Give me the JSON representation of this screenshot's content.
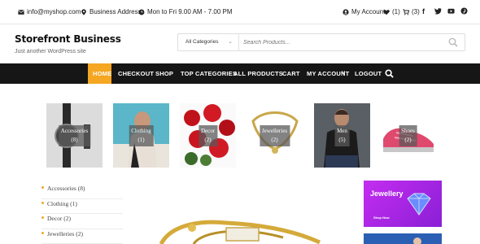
{
  "topbar": {
    "email": "info@myshop.com",
    "address": "Business Address",
    "hours": "Mon to Fri 9.00 AM - 7.00 PM",
    "account": "My Account",
    "wishlist_count": "(1)",
    "cart_count": "(3)",
    "social": [
      "f",
      "t",
      "y",
      "p"
    ]
  },
  "header": {
    "title": "Storefront Business",
    "tagline": "Just another WordPress site"
  },
  "search": {
    "category": "All Categories",
    "placeholder": "Search Products..."
  },
  "nav": {
    "items": [
      "HOME",
      "CHECKOUT",
      "SHOP",
      "TOP CATEGORIES",
      "ALL PRODUCTS",
      "CART",
      "MY ACCOUNT",
      "LOGOUT"
    ]
  },
  "categories": [
    {
      "name": "Accessories",
      "count": "(8)"
    },
    {
      "name": "Clothing",
      "count": "(1)"
    },
    {
      "name": "Decor",
      "count": "(2)"
    },
    {
      "name": "Jewelleries",
      "count": "(2)"
    },
    {
      "name": "Men",
      "count": "(5)"
    },
    {
      "name": "Shoes",
      "count": "(2)"
    }
  ],
  "sidebar": {
    "items": [
      "Accessories (8)",
      "Clothing (1)",
      "Decor (2)",
      "Jewelleries (2)"
    ]
  },
  "ads": {
    "ad1_title": "Jewellery",
    "ad1_button": "Shop Now"
  },
  "colors": {
    "accent": "#f5a623",
    "nav_bg": "#161616"
  }
}
